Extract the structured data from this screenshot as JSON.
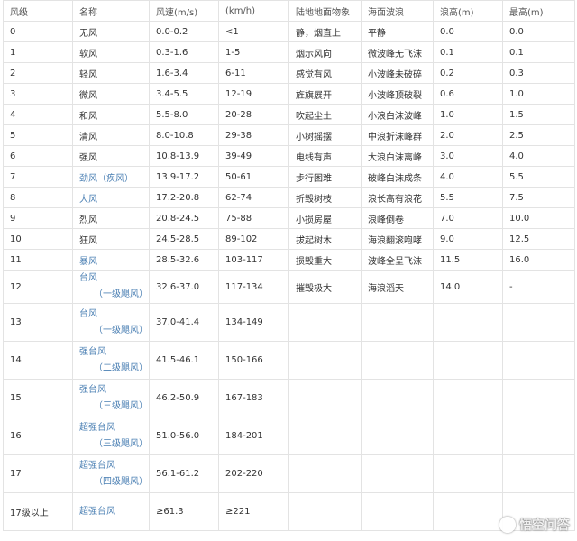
{
  "headers": [
    "风级",
    "名称",
    "风速(m/s)",
    "(km/h)",
    "陆地地面物象",
    "海面波浪",
    "浪高(m)",
    "最高(m)"
  ],
  "rows": [
    {
      "level": "0",
      "name": "无风",
      "ms": "0.0-0.2",
      "kmh": "<1",
      "land": "静，烟直上",
      "sea": "平静",
      "wave": "0.0",
      "max": "0.0"
    },
    {
      "level": "1",
      "name": "软风",
      "ms": "0.3-1.6",
      "kmh": "1-5",
      "land": "烟示风向",
      "sea": "微波峰无飞沫",
      "wave": "0.1",
      "max": "0.1"
    },
    {
      "level": "2",
      "name": "轻风",
      "ms": "1.6-3.4",
      "kmh": "6-11",
      "land": "感觉有风",
      "sea": "小波峰未破碎",
      "wave": "0.2",
      "max": "0.3"
    },
    {
      "level": "3",
      "name": "微风",
      "ms": "3.4-5.5",
      "kmh": "12-19",
      "land": "旌旗展开",
      "sea": "小波峰顶破裂",
      "wave": "0.6",
      "max": "1.0"
    },
    {
      "level": "4",
      "name": "和风",
      "ms": "5.5-8.0",
      "kmh": "20-28",
      "land": "吹起尘土",
      "sea": "小浪白沫波峰",
      "wave": "1.0",
      "max": "1.5"
    },
    {
      "level": "5",
      "name": "清风",
      "ms": "8.0-10.8",
      "kmh": "29-38",
      "land": "小树摇摆",
      "sea": "中浪折沫峰群",
      "wave": "2.0",
      "max": "2.5"
    },
    {
      "level": "6",
      "name": "强风",
      "ms": "10.8-13.9",
      "kmh": "39-49",
      "land": "电线有声",
      "sea": "大浪白沫离峰",
      "wave": "3.0",
      "max": "4.0"
    },
    {
      "level": "7",
      "name": "劲风（疾风）",
      "ms": "13.9-17.2",
      "kmh": "50-61",
      "land": "步行困难",
      "sea": "破峰白沫成条",
      "wave": "4.0",
      "max": "5.5"
    },
    {
      "level": "8",
      "name": "大风",
      "ms": "17.2-20.8",
      "kmh": "62-74",
      "land": "折毁树枝",
      "sea": "浪长高有浪花",
      "wave": "5.5",
      "max": "7.5"
    },
    {
      "level": "9",
      "name": "烈风",
      "ms": "20.8-24.5",
      "kmh": "75-88",
      "land": "小损房屋",
      "sea": "浪峰倒卷",
      "wave": "7.0",
      "max": "10.0"
    },
    {
      "level": "10",
      "name": "狂风",
      "ms": "24.5-28.5",
      "kmh": "89-102",
      "land": "拔起树木",
      "sea": "海浪翻滚咆哮",
      "wave": "9.0",
      "max": "12.5"
    },
    {
      "level": "11",
      "name": "暴风",
      "ms": "28.5-32.6",
      "kmh": "103-117",
      "land": "损毁重大",
      "sea": "波峰全呈飞沫",
      "wave": "11.5",
      "max": "16.0"
    }
  ],
  "typhoon_rows": [
    {
      "level": "12",
      "name": "台风",
      "sub": "（一级飓风）",
      "ms": "32.6-37.0",
      "kmh": "117-134",
      "land": "摧毁极大",
      "sea": "海浪滔天",
      "wave": "14.0",
      "max": "-"
    },
    {
      "level": "13",
      "name": "台风",
      "sub": "（一级飓风）",
      "ms": "37.0-41.4",
      "kmh": "134-149"
    },
    {
      "level": "14",
      "name": "强台风",
      "sub": "（二级飓风）",
      "ms": "41.5-46.1",
      "kmh": "150-166"
    },
    {
      "level": "15",
      "name": "强台风",
      "sub": "（三级飓风）",
      "ms": "46.2-50.9",
      "kmh": "167-183"
    },
    {
      "level": "16",
      "name": "超强台风",
      "sub": "（三级飓风）",
      "ms": "51.0-56.0",
      "kmh": "184-201"
    },
    {
      "level": "17",
      "name": "超强台风",
      "sub": "（四级飓风）",
      "ms": "56.1-61.2",
      "kmh": "202-220"
    },
    {
      "level": "17级以上",
      "name": "超强台风",
      "sub": "",
      "ms": "≥61.3",
      "kmh": "≥221"
    }
  ],
  "watermark": "悟空问答",
  "colors": {
    "border": "#e3e3e3",
    "link_blue": "#4a7fb3",
    "text": "#333333"
  }
}
